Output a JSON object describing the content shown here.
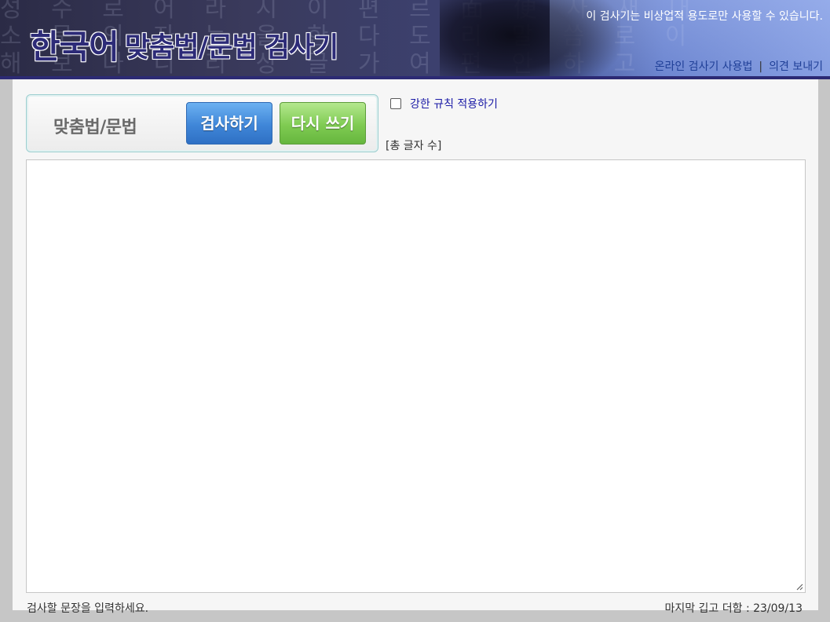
{
  "header": {
    "bg_chars": "성 수 로 어 라 시 이 편 르 面 便 사 새 내\n소 문 의 자 는 을 한 다 도 리 말 씀 로 이\n해 보 나 니 리 상 글 가 여 편 안 하 고",
    "logo_part1": "한국어",
    "logo_part2": "맞춤법/문법",
    "logo_part3": "검사기",
    "notice": "이 검사기는 비상업적 용도로만 사용할 수 있습니다.",
    "links": {
      "usage": "온라인 검사기 사용법",
      "separator": "|",
      "feedback": "의견 보내기"
    }
  },
  "controls": {
    "title": "맞춤법/문법",
    "check_button": "검사하기",
    "reset_button": "다시 쓰기",
    "strict_label": "강한 규칙 적용하기",
    "strict_checked": false,
    "char_count": "[총 글자 수]"
  },
  "editor": {
    "value": ""
  },
  "footer": {
    "hint": "검사할 문장을 입력하세요.",
    "updated": "마지막 깁고 더함 : 23/09/13"
  },
  "colors": {
    "logo": "#2d2b78",
    "header_line": "#2c2a74",
    "check_button": "#3f86d8",
    "reset_button": "#7fcb52",
    "strict_label": "#1a1aa6"
  }
}
